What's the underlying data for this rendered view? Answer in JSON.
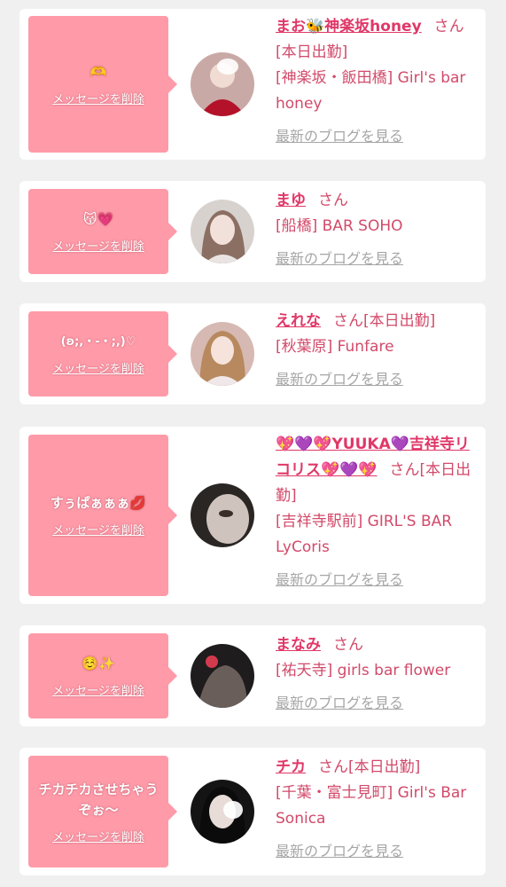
{
  "ui": {
    "delete_label": "メッセージを削除",
    "blog_label": "最新のブログを見る",
    "san": "さん"
  },
  "colors": {
    "page_bg": "#f0f0f0",
    "bubble": "#ff9aa8",
    "name": "#e03868",
    "link_gray": "#a6a6a6"
  },
  "entries": [
    {
      "message": "🫶",
      "name": "まお🐝神楽坂honey",
      "status": "[本日出勤]",
      "shop": "[神楽坂・飯田橋] Girl's bar honey"
    },
    {
      "message": "😽💗",
      "name": "まゆ",
      "status": "",
      "shop": "[船橋] BAR SOHO"
    },
    {
      "message": "(ʚ;,・-・;,)♡",
      "name": "えれな",
      "status": "[本日出勤]",
      "shop": "[秋葉原] Funfare"
    },
    {
      "message": "すぅぱぁぁぁ💋",
      "name": "💖💜💖YUUKA💜吉祥寺リコリス💖💜💖",
      "status": "[本日出勤]",
      "shop": "[吉祥寺駅前] GIRL'S BAR LyCoris"
    },
    {
      "message": "☺️✨",
      "name": "まなみ",
      "status": "",
      "shop": "[祐天寺] girls bar flower"
    },
    {
      "message": "チカチカさせちゃうぞぉ〜",
      "name": "チカ",
      "status": "[本日出勤]",
      "shop": "[千葉・富士見町] Girl's Bar Sonica"
    }
  ]
}
